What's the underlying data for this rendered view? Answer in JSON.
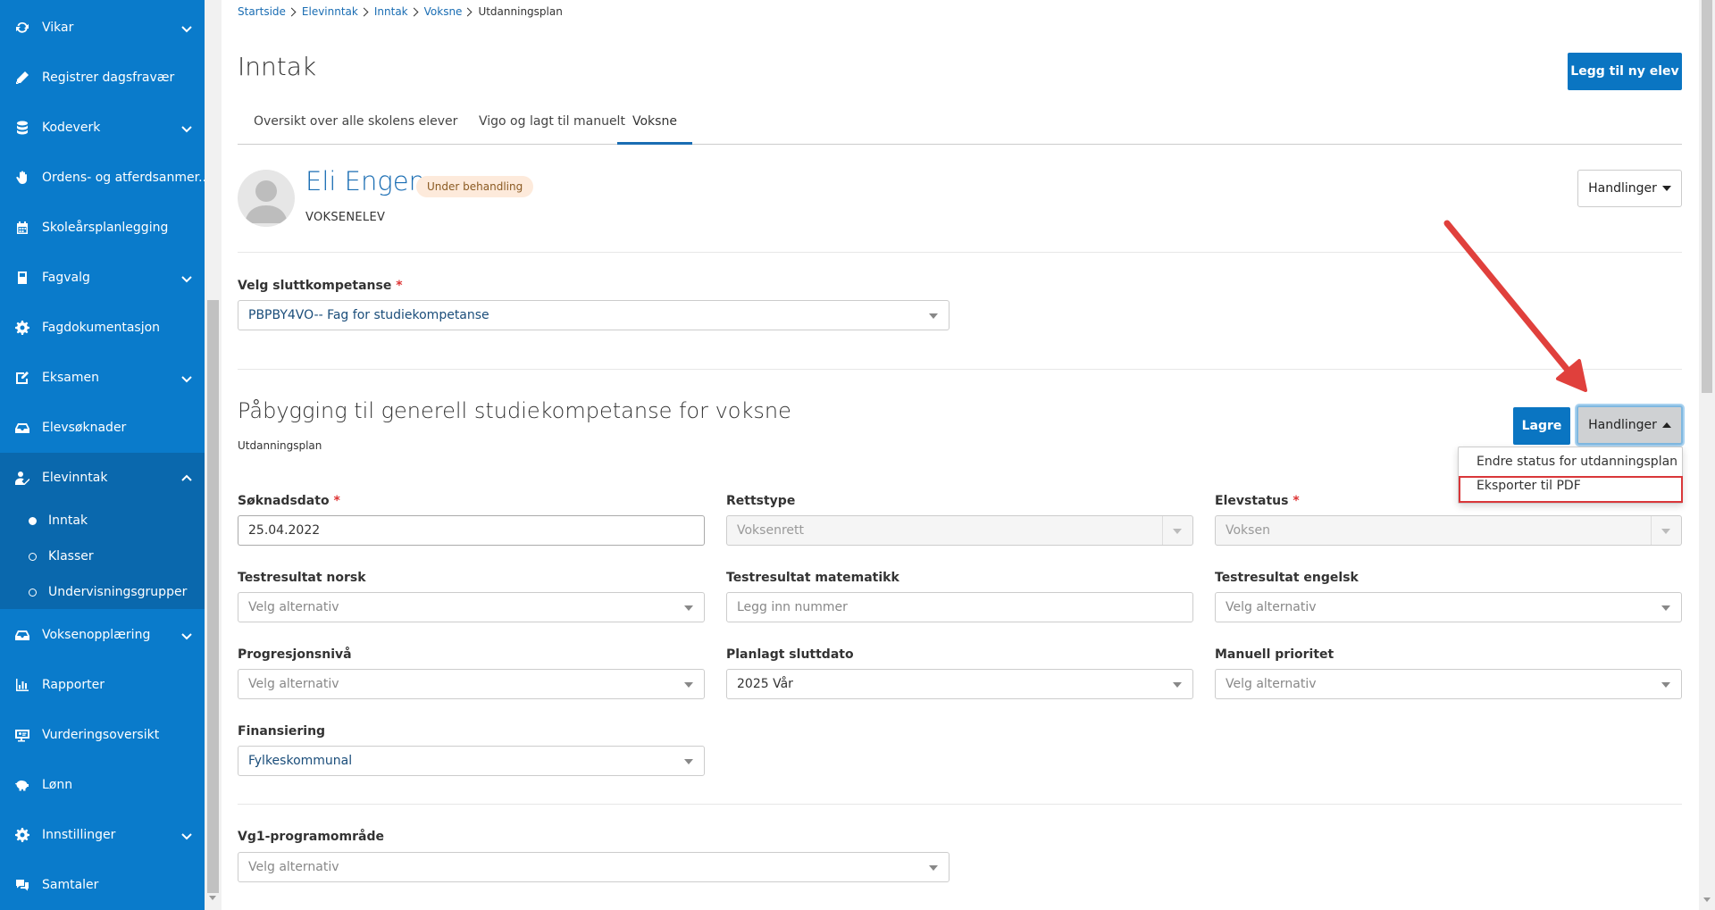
{
  "sidebar": {
    "items": [
      {
        "label": "Vikar",
        "icon": "refresh-icon",
        "chevron": "down"
      },
      {
        "label": "Registrer dagsfravær",
        "icon": "pencil-icon",
        "chevron": ""
      },
      {
        "label": "Kodeverk",
        "icon": "database-icon",
        "chevron": "down"
      },
      {
        "label": "Ordens- og atferdsanmer...",
        "icon": "hand-icon",
        "chevron": ""
      },
      {
        "label": "Skoleårsplanlegging",
        "icon": "calendar-icon",
        "chevron": ""
      },
      {
        "label": "Fagvalg",
        "icon": "book-icon",
        "chevron": "down"
      },
      {
        "label": "Fagdokumentasjon",
        "icon": "gear-icon",
        "chevron": ""
      },
      {
        "label": "Eksamen",
        "icon": "edit-chart-icon",
        "chevron": "down"
      },
      {
        "label": "Elevsøknader",
        "icon": "inbox-icon",
        "chevron": ""
      },
      {
        "label": "Elevinntak",
        "icon": "user-check-icon",
        "chevron": "up"
      },
      {
        "label": "Voksenopplæring",
        "icon": "inbox-icon",
        "chevron": "down"
      },
      {
        "label": "Rapporter",
        "icon": "bar-chart-icon",
        "chevron": ""
      },
      {
        "label": "Vurderingsoversikt",
        "icon": "id-card-icon",
        "chevron": ""
      },
      {
        "label": "Lønn",
        "icon": "piggy-bank-icon",
        "chevron": ""
      },
      {
        "label": "Innstillinger",
        "icon": "gear-icon",
        "chevron": "down"
      },
      {
        "label": "Samtaler",
        "icon": "chat-icon",
        "chevron": ""
      }
    ],
    "subitems": [
      {
        "label": "Inntak",
        "active": true
      },
      {
        "label": "Klasser",
        "active": false
      },
      {
        "label": "Undervisningsgrupper",
        "active": false
      }
    ]
  },
  "breadcrumb": [
    "Startside",
    "Elevinntak",
    "Inntak",
    "Voksne",
    "Utdanningsplan"
  ],
  "page": {
    "title": "Inntak",
    "add_button": "Legg til ny elev"
  },
  "tabs": [
    "Oversikt over alle skolens elever",
    "Vigo og lagt til manuelt",
    "Voksne"
  ],
  "student": {
    "name": "Eli Engen",
    "status_badge": "Under behandling",
    "type": "VOKSENELEV",
    "actions_label": "Handlinger"
  },
  "sluttkompetanse": {
    "label": "Velg sluttkompetanse",
    "value": "PBPBY4VO-- Fag for studiekompetanse"
  },
  "section": {
    "title": "Påbygging til generell studiekompetanse for voksne",
    "subtitle": "Utdanningsplan",
    "save_label": "Lagre",
    "actions_label": "Handlinger",
    "dropdown": [
      "Endre status for utdanningsplan",
      "Eksporter til PDF"
    ]
  },
  "fields": {
    "soknadsdato": {
      "label": "Søknadsdato",
      "value": "25.04.2022"
    },
    "rettstype": {
      "label": "Rettstype",
      "value": "Voksenrett"
    },
    "elevstatus": {
      "label": "Elevstatus",
      "value": "Voksen"
    },
    "test_norsk": {
      "label": "Testresultat norsk",
      "placeholder": "Velg alternativ"
    },
    "test_matte": {
      "label": "Testresultat matematikk",
      "placeholder": "Legg inn nummer"
    },
    "test_engelsk": {
      "label": "Testresultat engelsk",
      "placeholder": "Velg alternativ"
    },
    "progresjon": {
      "label": "Progresjonsnivå",
      "placeholder": "Velg alternativ"
    },
    "sluttdato": {
      "label": "Planlagt sluttdato",
      "value": "2025 Vår"
    },
    "prioritet": {
      "label": "Manuell prioritet",
      "placeholder": "Velg alternativ"
    },
    "finansiering": {
      "label": "Finansiering",
      "value": "Fylkeskommunal"
    },
    "vg1": {
      "label": "Vg1-programområde",
      "placeholder": "Velg alternativ"
    }
  },
  "colors": {
    "sidebar": "#0a7bcb",
    "primary": "#0a75c2",
    "annotation": "#d9373a"
  }
}
